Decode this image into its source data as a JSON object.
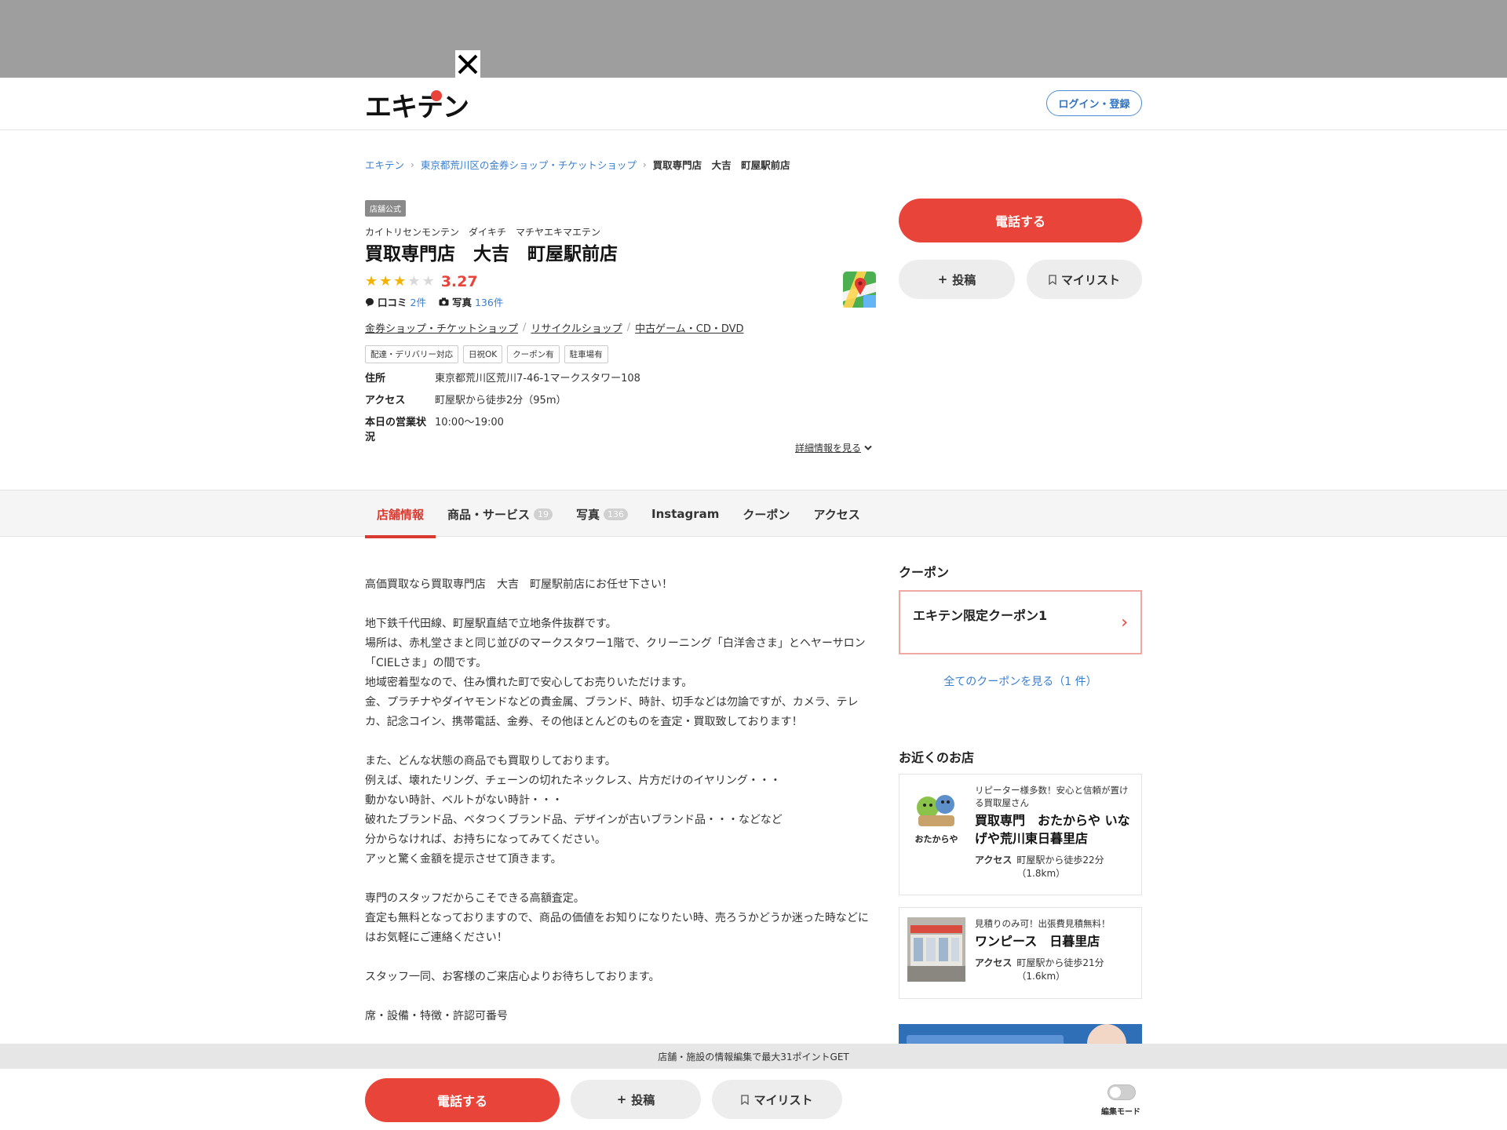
{
  "header": {
    "logo_text": "エキテン",
    "login_label": "ログイン・登録"
  },
  "breadcrumb": {
    "home": "エキテン",
    "category": "東京都荒川区の金券ショップ・チケットショップ",
    "current": "買取専門店　大吉　町屋駅前店"
  },
  "shop": {
    "official_tag": "店舗公式",
    "kana": "カイトリセンモンテン　ダイキチ　マチヤエキマエテン",
    "name": "買取専門店　大吉　町屋駅前店",
    "rating": "3.27",
    "rating_stars": 3,
    "review_label": "口コミ",
    "review_count": "2件",
    "photo_label": "写真",
    "photo_count": "136件",
    "categories": [
      "金券ショップ・チケットショップ",
      "リサイクルショップ",
      "中古ゲーム・CD・DVD"
    ],
    "tags": [
      "配達・デリバリー対応",
      "日祝OK",
      "クーポン有",
      "駐車場有"
    ],
    "address_label": "住所",
    "address": "東京都荒川区荒川7-46-1マークスタワー108",
    "access_label": "アクセス",
    "access": "町屋駅から徒歩2分（95m）",
    "hours_label": "本日の営業状況",
    "hours": "10:00〜19:00",
    "detail_link": "詳細情報を見る"
  },
  "actions": {
    "call": "電話する",
    "post": "投稿",
    "mylist": "マイリスト"
  },
  "tabs": [
    {
      "label": "店舗情報",
      "badge": ""
    },
    {
      "label": "商品・サービス",
      "badge": "19"
    },
    {
      "label": "写真",
      "badge": "136"
    },
    {
      "label": "Instagram",
      "badge": ""
    },
    {
      "label": "クーポン",
      "badge": ""
    },
    {
      "label": "アクセス",
      "badge": ""
    }
  ],
  "description": [
    "高価買取なら買取専門店　大吉　町屋駅前店にお任せ下さい！",
    "地下鉄千代田線、町屋駅直結で立地条件抜群です。\n場所は、赤札堂さまと同じ並びのマークスタワー1階で、クリーニング「白洋舎さま」とヘヤーサロン「CIELさま」の間です。\n地域密着型なので、住み慣れた町で安心してお売りいただけます。\n金、プラチナやダイヤモンドなどの貴金属、ブランド、時計、切手などは勿論ですが、カメラ、テレカ、記念コイン、携帯電話、金券、その他ほとんどのものを査定・買取致しております！",
    "また、どんな状態の商品でも買取りしております。\n例えば、壊れたリング、チェーンの切れたネックレス、片方だけのイヤリング・・・\n動かない時計、ベルトがない時計・・・\n破れたブランド品、ベタつくブランド品、デザインが古いブランド品・・・などなど\n分からなければ、お持ちになってみてください。\nアッと驚く金額を提示させて頂きます。",
    "専門のスタッフだからこそできる高額査定。\n査定も無料となっておりますので、商品の価値をお知りになりたい時、売ろうかどうか迷った時などにはお気軽にご連絡ください！",
    "スタッフ一同、お客様のご来店心よりお待ちしております。",
    "席・設備・特徴・許認可番号"
  ],
  "sidebar": {
    "coupon_title": "クーポン",
    "coupon_name": "エキテン限定クーポン1",
    "coupon_all": "全てのクーポンを見る（1 件）",
    "nearby_title": "お近くのお店",
    "nearby": [
      {
        "catch": "リピーター様多数！安心と信頼が置ける買取屋さん",
        "name": "買取専門　おたからや いなげや荒川東日暮里店",
        "access_label": "アクセス",
        "access": "町屋駅から徒歩22分（1.8km）",
        "thumb_text": "おたからや"
      },
      {
        "catch": "見積りのみ可！出張費見積無料！",
        "name": "ワンピース　日暮里店",
        "access_label": "アクセス",
        "access": "町屋駅から徒歩21分（1.6km）",
        "thumb_text": ""
      }
    ]
  },
  "bottom": {
    "points_text": "店舗・施設の情報編集で最大31ポイントGET",
    "call": "電話する",
    "post": "投稿",
    "mylist": "マイリスト",
    "edit_mode": "編集モード"
  },
  "colors": {
    "accent_red": "#e8443a",
    "link_blue": "#3a7fcf",
    "star_yellow": "#f5b301"
  }
}
